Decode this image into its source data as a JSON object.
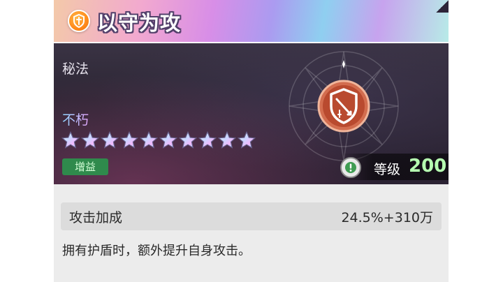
{
  "skill": {
    "title": "以守为攻",
    "icon": "shield-sword-icon",
    "category": "秘法",
    "rarity": "不朽",
    "stars": 10,
    "tag": "增益",
    "level_label": "等级",
    "level_value": "200"
  },
  "stat": {
    "name": "攻击加成",
    "value": "24.5%+310万"
  },
  "description": "拥有护盾时，额外提升自身攻击。",
  "colors": {
    "tag_bg": "#2f8a4c",
    "level_value": "#b6ffb1",
    "header_icon": "#ff8a1a",
    "emblem": "#c44a30"
  }
}
